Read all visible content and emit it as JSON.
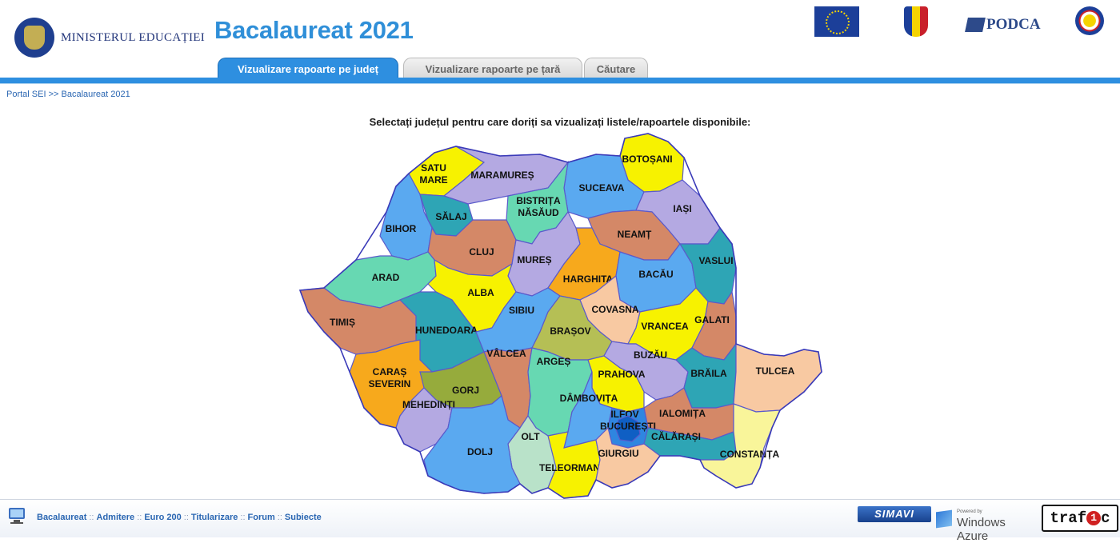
{
  "header": {
    "ministry": "MINISTERUL EDUCAȚIEI",
    "title": "Bacalaureat 2021",
    "podca": "PODCA"
  },
  "tabs": [
    {
      "label": "Vizualizare rapoarte pe județ",
      "active": true
    },
    {
      "label": "Vizualizare rapoarte pe țară",
      "active": false
    },
    {
      "label": "Căutare",
      "active": false
    }
  ],
  "breadcrumb": {
    "portal": "Portal SEI",
    "separator": ">>",
    "current": "Bacalaureat 2021"
  },
  "instruction": "Selectați județul pentru care doriți sa vizualizați listele/rapoartele disponibile:",
  "counties": [
    {
      "id": "satu-mare",
      "label": [
        "SATU",
        "MARE"
      ],
      "color": "#f7f200"
    },
    {
      "id": "maramures",
      "label": [
        "MARAMUREȘ"
      ],
      "color": "#b4a9e2"
    },
    {
      "id": "botosani",
      "label": [
        "BOTOȘANI"
      ],
      "color": "#f7f200"
    },
    {
      "id": "suceava",
      "label": [
        "SUCEAVA"
      ],
      "color": "#5aa9f0"
    },
    {
      "id": "bihor",
      "label": [
        "BIHOR"
      ],
      "color": "#5aa9f0"
    },
    {
      "id": "salaj",
      "label": [
        "SĂLAJ"
      ],
      "color": "#2ea5b5"
    },
    {
      "id": "bistrita-nasaud",
      "label": [
        "BISTRIȚA",
        "NĂSĂUD"
      ],
      "color": "#67d8b2"
    },
    {
      "id": "iasi",
      "label": [
        "IAȘI"
      ],
      "color": "#b4a9e2"
    },
    {
      "id": "neamt",
      "label": [
        "NEAMȚ"
      ],
      "color": "#d48867"
    },
    {
      "id": "cluj",
      "label": [
        "CLUJ"
      ],
      "color": "#d48867"
    },
    {
      "id": "mures",
      "label": [
        "MUREȘ"
      ],
      "color": "#b4a9e2"
    },
    {
      "id": "harghita",
      "label": [
        "HARGHITA"
      ],
      "color": "#f7a91c"
    },
    {
      "id": "bacau",
      "label": [
        "BACĂU"
      ],
      "color": "#5aa9f0"
    },
    {
      "id": "vaslui",
      "label": [
        "VASLUI"
      ],
      "color": "#2ea5b5"
    },
    {
      "id": "arad",
      "label": [
        "ARAD"
      ],
      "color": "#67d8b2"
    },
    {
      "id": "alba",
      "label": [
        "ALBA"
      ],
      "color": "#f7f200"
    },
    {
      "id": "timis",
      "label": [
        "TIMIȘ"
      ],
      "color": "#d48867"
    },
    {
      "id": "hunedoara",
      "label": [
        "HUNEDOARA"
      ],
      "color": "#2ea5b5"
    },
    {
      "id": "sibiu",
      "label": [
        "SIBIU"
      ],
      "color": "#5aa9f0"
    },
    {
      "id": "covasna",
      "label": [
        "COVASNA"
      ],
      "color": "#f8c9a2"
    },
    {
      "id": "brasov",
      "label": [
        "BRAȘOV"
      ],
      "color": "#b5bf55"
    },
    {
      "id": "vrancea",
      "label": [
        "VRANCEA"
      ],
      "color": "#f7f200"
    },
    {
      "id": "galati",
      "label": [
        "GALATI"
      ],
      "color": "#d48867"
    },
    {
      "id": "valcea",
      "label": [
        "VÂLCEA"
      ],
      "color": "#d48867"
    },
    {
      "id": "arges",
      "label": [
        "ARGEȘ"
      ],
      "color": "#67d8b2"
    },
    {
      "id": "buzau",
      "label": [
        "BUZĂU"
      ],
      "color": "#b4a9e2"
    },
    {
      "id": "braila",
      "label": [
        "BRĂILA"
      ],
      "color": "#2ea5b5"
    },
    {
      "id": "tulcea",
      "label": [
        "TULCEA"
      ],
      "color": "#f8c9a2"
    },
    {
      "id": "caras-severin",
      "label": [
        "CARAȘ",
        "SEVERIN"
      ],
      "color": "#f7a91c"
    },
    {
      "id": "gorj",
      "label": [
        "GORJ"
      ],
      "color": "#96ab3c"
    },
    {
      "id": "prahova",
      "label": [
        "PRAHOVA"
      ],
      "color": "#f7f200"
    },
    {
      "id": "mehedinti",
      "label": [
        "MEHEDINȚI"
      ],
      "color": "#b4a9e2"
    },
    {
      "id": "dambovita",
      "label": [
        "DÂMBOVIȚA"
      ],
      "color": "#5aa9f0"
    },
    {
      "id": "ialomita",
      "label": [
        "IALOMIȚA"
      ],
      "color": "#d48867"
    },
    {
      "id": "ilfov",
      "label": [
        "ILFOV"
      ],
      "color": "#2f86e0"
    },
    {
      "id": "bucuresti",
      "label": [
        "BUCUREȘTI"
      ],
      "color": "#0f5fc4"
    },
    {
      "id": "calarasi",
      "label": [
        "CĂLĂRAȘI"
      ],
      "color": "#2ea5b5"
    },
    {
      "id": "olt",
      "label": [
        "OLT"
      ],
      "color": "#b9e2c9"
    },
    {
      "id": "dolj",
      "label": [
        "DOLJ"
      ],
      "color": "#5aa9f0"
    },
    {
      "id": "teleorman",
      "label": [
        "TELEORMAN"
      ],
      "color": "#f7f200"
    },
    {
      "id": "giurgiu",
      "label": [
        "GIURGIU"
      ],
      "color": "#f8c9a2"
    },
    {
      "id": "constanta",
      "label": [
        "CONSTANȚA"
      ],
      "color": "#f9f59a"
    }
  ],
  "footer": {
    "links": [
      "Bacalaureat",
      "Admitere",
      "Euro 200",
      "Titularizare",
      "Forum",
      "Subiecte"
    ],
    "separator": "::",
    "simavi": "SIMAVI",
    "azure_small": "Powered by",
    "azure": "Windows Azure",
    "trafic_a": "traf",
    "trafic_b": "1",
    "trafic_c": "c"
  }
}
